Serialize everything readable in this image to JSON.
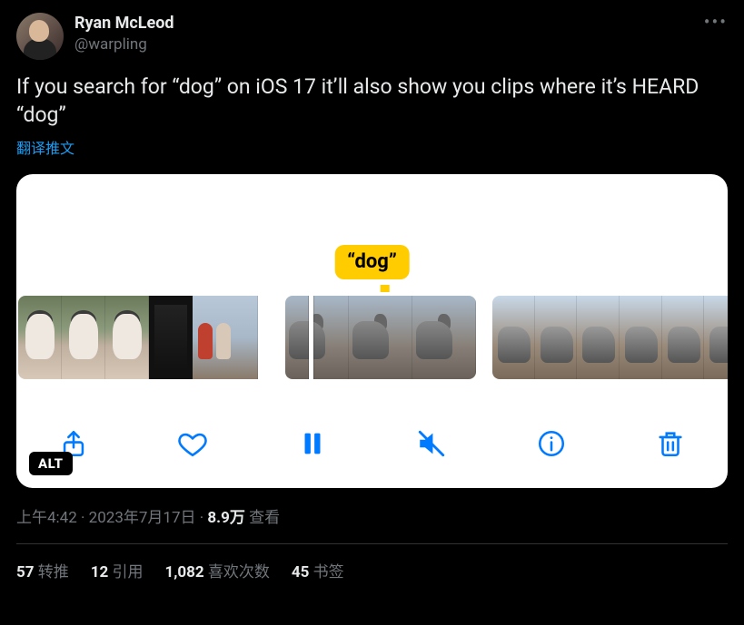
{
  "author": {
    "display_name": "Ryan McLeod",
    "handle": "@warpling"
  },
  "tweet_text": "If you search for “dog” on iOS 17 it’ll also show you clips where it’s HEARD “dog”",
  "translate_label": "翻译推文",
  "media": {
    "search_term_label": "“dog”",
    "alt_badge": "ALT",
    "toolbar": {
      "share": "share-icon",
      "like": "heart-icon",
      "pause": "pause-icon",
      "mute": "mute-icon",
      "info": "info-icon",
      "trash": "trash-icon"
    }
  },
  "meta": {
    "time": "上午4:42",
    "sep1": " · ",
    "date": "2023年7月17日",
    "sep2": " · ",
    "views_count": "8.9万",
    "views_label": " 查看"
  },
  "stats": {
    "retweets_count": "57",
    "retweets_label": " 转推",
    "quotes_count": "12",
    "quotes_label": " 引用",
    "likes_count": "1,082",
    "likes_label": " 喜欢次数",
    "bookmarks_count": "45",
    "bookmarks_label": " 书签"
  }
}
